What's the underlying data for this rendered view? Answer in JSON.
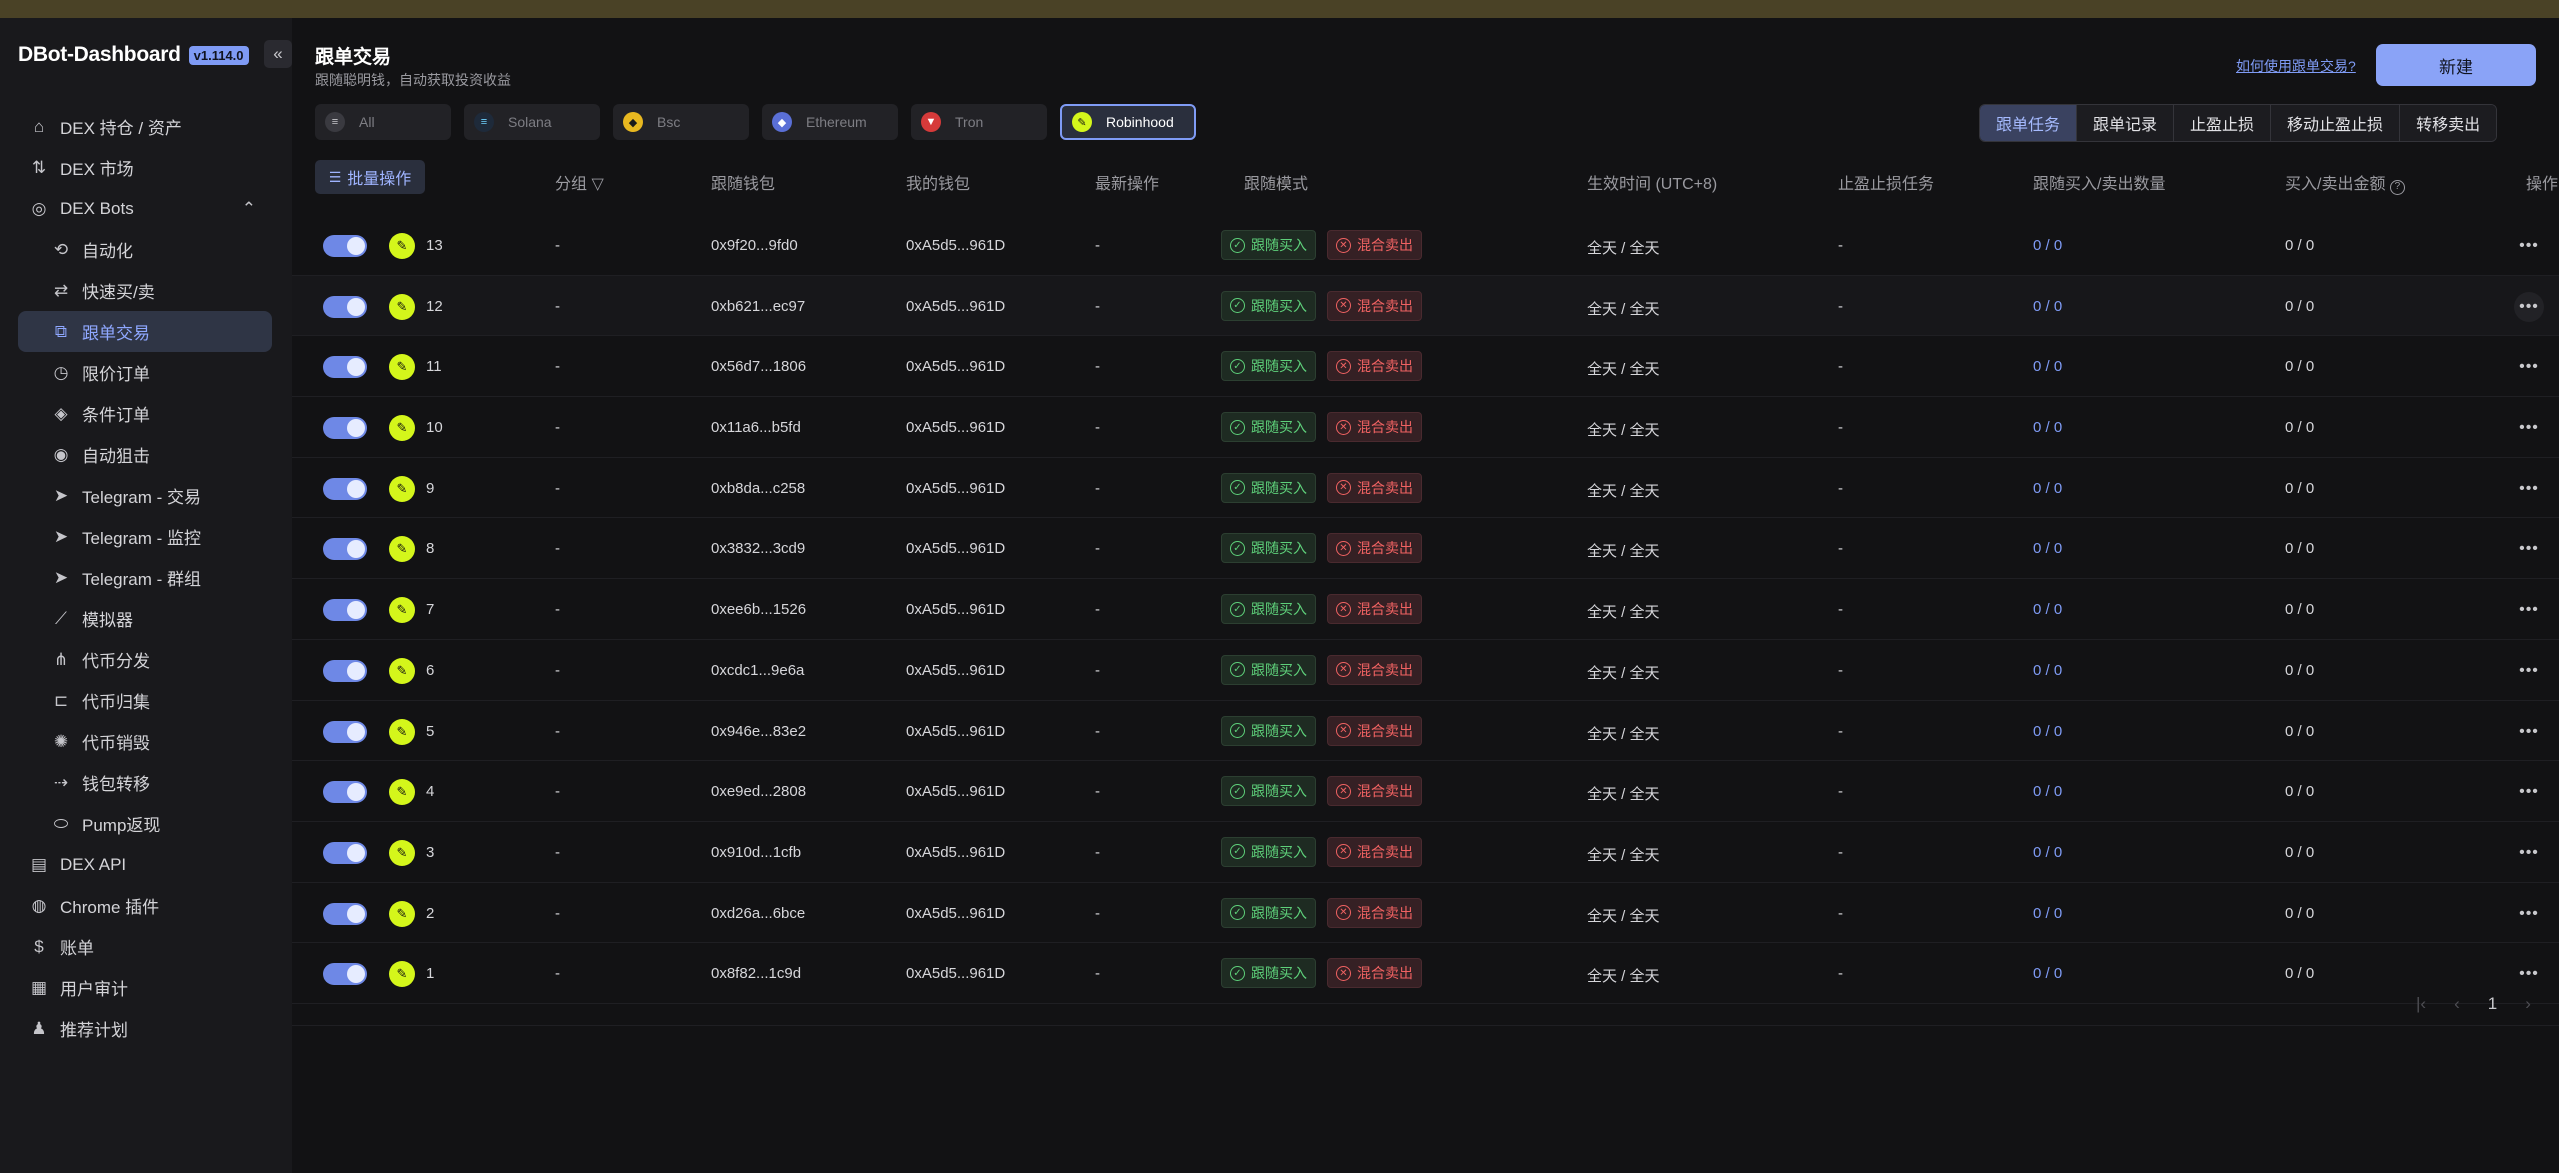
{
  "app": {
    "logo": "DBot-Dashboard",
    "version": "v1.114.0"
  },
  "sidebar": {
    "items": [
      {
        "label": "DEX 持仓 / 资产",
        "icon": "home-icon"
      },
      {
        "label": "DEX 市场",
        "icon": "market-icon"
      },
      {
        "label": "DEX Bots",
        "icon": "bot-icon",
        "expanded": true
      },
      {
        "label": "自动化",
        "icon": "automation-icon",
        "sub": true
      },
      {
        "label": "快速买/卖",
        "icon": "quick-trade-icon",
        "sub": true
      },
      {
        "label": "跟单交易",
        "icon": "copy-trade-icon",
        "sub": true,
        "active": true
      },
      {
        "label": "限价订单",
        "icon": "limit-order-icon",
        "sub": true
      },
      {
        "label": "条件订单",
        "icon": "condition-order-icon",
        "sub": true
      },
      {
        "label": "自动狙击",
        "icon": "snipe-icon",
        "sub": true
      },
      {
        "label": "Telegram - 交易",
        "icon": "telegram-icon",
        "sub": true
      },
      {
        "label": "Telegram - 监控",
        "icon": "telegram-icon",
        "sub": true
      },
      {
        "label": "Telegram - 群组",
        "icon": "telegram-icon",
        "sub": true
      },
      {
        "label": "模拟器",
        "icon": "simulator-icon",
        "sub": true
      },
      {
        "label": "代币分发",
        "icon": "distribute-icon",
        "sub": true
      },
      {
        "label": "代币归集",
        "icon": "collect-icon",
        "sub": true
      },
      {
        "label": "代币销毁",
        "icon": "burn-icon",
        "sub": true
      },
      {
        "label": "钱包转移",
        "icon": "transfer-icon",
        "sub": true
      },
      {
        "label": "Pump返现",
        "icon": "cashback-icon",
        "sub": true
      },
      {
        "label": "DEX API",
        "icon": "api-icon"
      },
      {
        "label": "Chrome 插件",
        "icon": "chrome-icon"
      },
      {
        "label": "账单",
        "icon": "bill-icon"
      },
      {
        "label": "用户审计",
        "icon": "audit-icon"
      },
      {
        "label": "推荐计划",
        "icon": "referral-icon"
      }
    ]
  },
  "header": {
    "title": "跟单交易",
    "subtitle": "跟随聪明钱，自动获取投资收益",
    "help_link": "如何使用跟单交易?",
    "new_button": "新建"
  },
  "chains": [
    {
      "label": "All",
      "icon": "layers-icon"
    },
    {
      "label": "Solana",
      "icon": "solana-icon"
    },
    {
      "label": "Bsc",
      "icon": "bsc-icon"
    },
    {
      "label": "Ethereum",
      "icon": "ethereum-icon"
    },
    {
      "label": "Tron",
      "icon": "tron-icon"
    },
    {
      "label": "Robinhood",
      "icon": "robinhood-icon",
      "active": true
    }
  ],
  "tabs": [
    {
      "label": "跟单任务",
      "active": true
    },
    {
      "label": "跟单记录"
    },
    {
      "label": "止盈止损"
    },
    {
      "label": "移动止盈止损"
    },
    {
      "label": "转移卖出"
    }
  ],
  "table": {
    "batch_button": "批量操作",
    "columns": {
      "group": "分组",
      "follow_wallet": "跟随钱包",
      "my_wallet": "我的钱包",
      "latest": "最新操作",
      "mode": "跟随模式",
      "time": "生效时间 (UTC+8)",
      "tpsl": "止盈止损任务",
      "qty": "跟随买入/卖出数量",
      "amount": "买入/卖出金额",
      "ops": "操作"
    },
    "rows": [
      {
        "id": "13",
        "group": "-",
        "follow_wallet": "0x9f20...9fd0",
        "my_wallet": "0xA5d5...961D",
        "latest": "-",
        "buy_tag": "跟随买入",
        "sell_tag": "混合卖出",
        "time": "全天 / 全天",
        "tpsl": "-",
        "qty": "0 / 0",
        "amount": "0 / 0"
      },
      {
        "id": "12",
        "group": "-",
        "follow_wallet": "0xb621...ec97",
        "my_wallet": "0xA5d5...961D",
        "latest": "-",
        "buy_tag": "跟随买入",
        "sell_tag": "混合卖出",
        "time": "全天 / 全天",
        "tpsl": "-",
        "qty": "0 / 0",
        "amount": "0 / 0"
      },
      {
        "id": "11",
        "group": "-",
        "follow_wallet": "0x56d7...1806",
        "my_wallet": "0xA5d5...961D",
        "latest": "-",
        "buy_tag": "跟随买入",
        "sell_tag": "混合卖出",
        "time": "全天 / 全天",
        "tpsl": "-",
        "qty": "0 / 0",
        "amount": "0 / 0"
      },
      {
        "id": "10",
        "group": "-",
        "follow_wallet": "0x11a6...b5fd",
        "my_wallet": "0xA5d5...961D",
        "latest": "-",
        "buy_tag": "跟随买入",
        "sell_tag": "混合卖出",
        "time": "全天 / 全天",
        "tpsl": "-",
        "qty": "0 / 0",
        "amount": "0 / 0"
      },
      {
        "id": "9",
        "group": "-",
        "follow_wallet": "0xb8da...c258",
        "my_wallet": "0xA5d5...961D",
        "latest": "-",
        "buy_tag": "跟随买入",
        "sell_tag": "混合卖出",
        "time": "全天 / 全天",
        "tpsl": "-",
        "qty": "0 / 0",
        "amount": "0 / 0"
      },
      {
        "id": "8",
        "group": "-",
        "follow_wallet": "0x3832...3cd9",
        "my_wallet": "0xA5d5...961D",
        "latest": "-",
        "buy_tag": "跟随买入",
        "sell_tag": "混合卖出",
        "time": "全天 / 全天",
        "tpsl": "-",
        "qty": "0 / 0",
        "amount": "0 / 0"
      },
      {
        "id": "7",
        "group": "-",
        "follow_wallet": "0xee6b...1526",
        "my_wallet": "0xA5d5...961D",
        "latest": "-",
        "buy_tag": "跟随买入",
        "sell_tag": "混合卖出",
        "time": "全天 / 全天",
        "tpsl": "-",
        "qty": "0 / 0",
        "amount": "0 / 0"
      },
      {
        "id": "6",
        "group": "-",
        "follow_wallet": "0xcdc1...9e6a",
        "my_wallet": "0xA5d5...961D",
        "latest": "-",
        "buy_tag": "跟随买入",
        "sell_tag": "混合卖出",
        "time": "全天 / 全天",
        "tpsl": "-",
        "qty": "0 / 0",
        "amount": "0 / 0"
      },
      {
        "id": "5",
        "group": "-",
        "follow_wallet": "0x946e...83e2",
        "my_wallet": "0xA5d5...961D",
        "latest": "-",
        "buy_tag": "跟随买入",
        "sell_tag": "混合卖出",
        "time": "全天 / 全天",
        "tpsl": "-",
        "qty": "0 / 0",
        "amount": "0 / 0"
      },
      {
        "id": "4",
        "group": "-",
        "follow_wallet": "0xe9ed...2808",
        "my_wallet": "0xA5d5...961D",
        "latest": "-",
        "buy_tag": "跟随买入",
        "sell_tag": "混合卖出",
        "time": "全天 / 全天",
        "tpsl": "-",
        "qty": "0 / 0",
        "amount": "0 / 0"
      },
      {
        "id": "3",
        "group": "-",
        "follow_wallet": "0x910d...1cfb",
        "my_wallet": "0xA5d5...961D",
        "latest": "-",
        "buy_tag": "跟随买入",
        "sell_tag": "混合卖出",
        "time": "全天 / 全天",
        "tpsl": "-",
        "qty": "0 / 0",
        "amount": "0 / 0"
      },
      {
        "id": "2",
        "group": "-",
        "follow_wallet": "0xd26a...6bce",
        "my_wallet": "0xA5d5...961D",
        "latest": "-",
        "buy_tag": "跟随买入",
        "sell_tag": "混合卖出",
        "time": "全天 / 全天",
        "tpsl": "-",
        "qty": "0 / 0",
        "amount": "0 / 0"
      },
      {
        "id": "1",
        "group": "-",
        "follow_wallet": "0x8f82...1c9d",
        "my_wallet": "0xA5d5...961D",
        "latest": "-",
        "buy_tag": "跟随买入",
        "sell_tag": "混合卖出",
        "time": "全天 / 全天",
        "tpsl": "-",
        "qty": "0 / 0",
        "amount": "0 / 0"
      }
    ]
  },
  "pagination": {
    "current": "1"
  },
  "colors": {
    "accent": "#7f9bf5",
    "buy": "#5ed07a",
    "sell": "#f06262",
    "robinhood": "#d4f61b"
  }
}
